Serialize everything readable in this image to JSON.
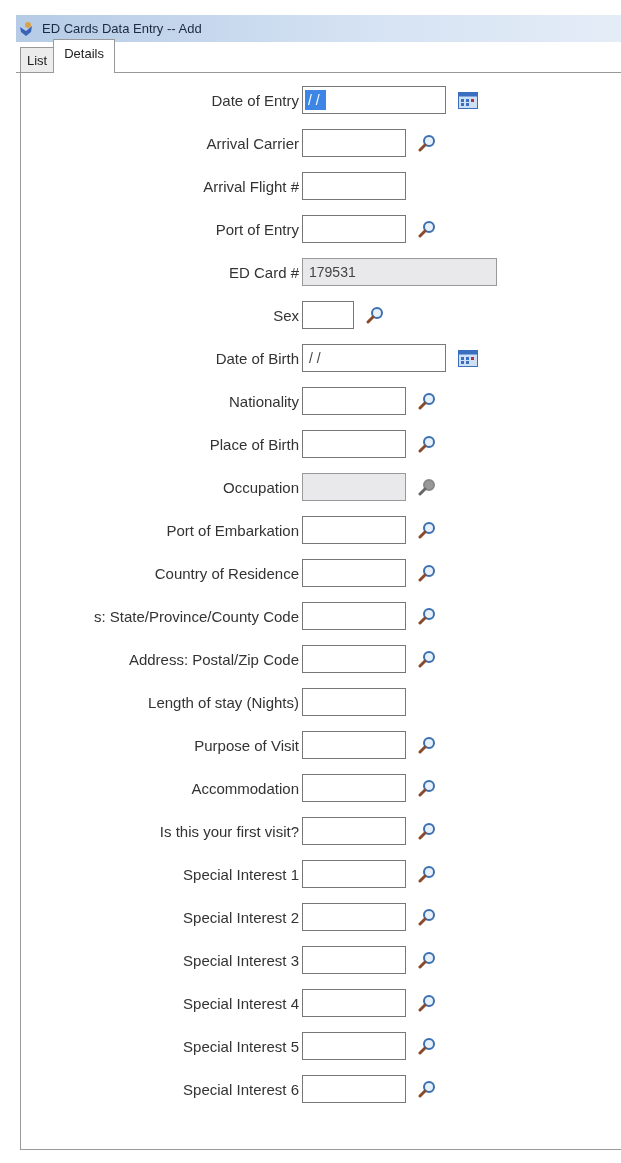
{
  "window": {
    "title": "ED Cards Data Entry -- Add"
  },
  "tabs": [
    {
      "label": "List",
      "selected": false
    },
    {
      "label": "Details",
      "selected": true
    }
  ],
  "fields": [
    {
      "label": "Date of Entry",
      "kind": "date",
      "value": "/ /",
      "highlighted": true,
      "disabled": false
    },
    {
      "label": "Arrival Carrier",
      "kind": "lookup",
      "disabled": false
    },
    {
      "label": "Arrival Flight #",
      "kind": "text",
      "disabled": false
    },
    {
      "label": "Port of Entry",
      "kind": "lookup",
      "disabled": false
    },
    {
      "label": "ED Card #",
      "kind": "serial",
      "value": "179531",
      "highlighted": false,
      "disabled": true
    },
    {
      "label": "Sex",
      "kind": "code",
      "disabled": false
    },
    {
      "label": "Date of Birth",
      "kind": "date",
      "value": "/ /",
      "highlighted": false,
      "disabled": false
    },
    {
      "label": "Nationality",
      "kind": "lookup",
      "disabled": false
    },
    {
      "label": "Place of Birth",
      "kind": "lookup",
      "disabled": false
    },
    {
      "label": "Occupation",
      "kind": "lookup",
      "disabled": true
    },
    {
      "label": "Port of Embarkation",
      "kind": "lookup",
      "disabled": false
    },
    {
      "label": "Country of Residence",
      "kind": "lookup",
      "disabled": false
    },
    {
      "label": "s: State/Province/County Code",
      "kind": "lookup",
      "disabled": false
    },
    {
      "label": "Address: Postal/Zip Code",
      "kind": "lookup",
      "disabled": false
    },
    {
      "label": "Length of stay (Nights)",
      "kind": "text",
      "disabled": false
    },
    {
      "label": "Purpose of Visit",
      "kind": "lookup",
      "disabled": false
    },
    {
      "label": "Accommodation",
      "kind": "lookup",
      "disabled": false
    },
    {
      "label": "Is this your first visit?",
      "kind": "lookup",
      "disabled": false
    },
    {
      "label": "Special Interest 1",
      "kind": "lookup",
      "disabled": false
    },
    {
      "label": "Special Interest 2",
      "kind": "lookup",
      "disabled": false
    },
    {
      "label": "Special Interest 3",
      "kind": "lookup",
      "disabled": false
    },
    {
      "label": "Special Interest 4",
      "kind": "lookup",
      "disabled": false
    },
    {
      "label": "Special Interest 5",
      "kind": "lookup",
      "disabled": false
    },
    {
      "label": "Special Interest 6",
      "kind": "lookup",
      "disabled": false
    }
  ]
}
